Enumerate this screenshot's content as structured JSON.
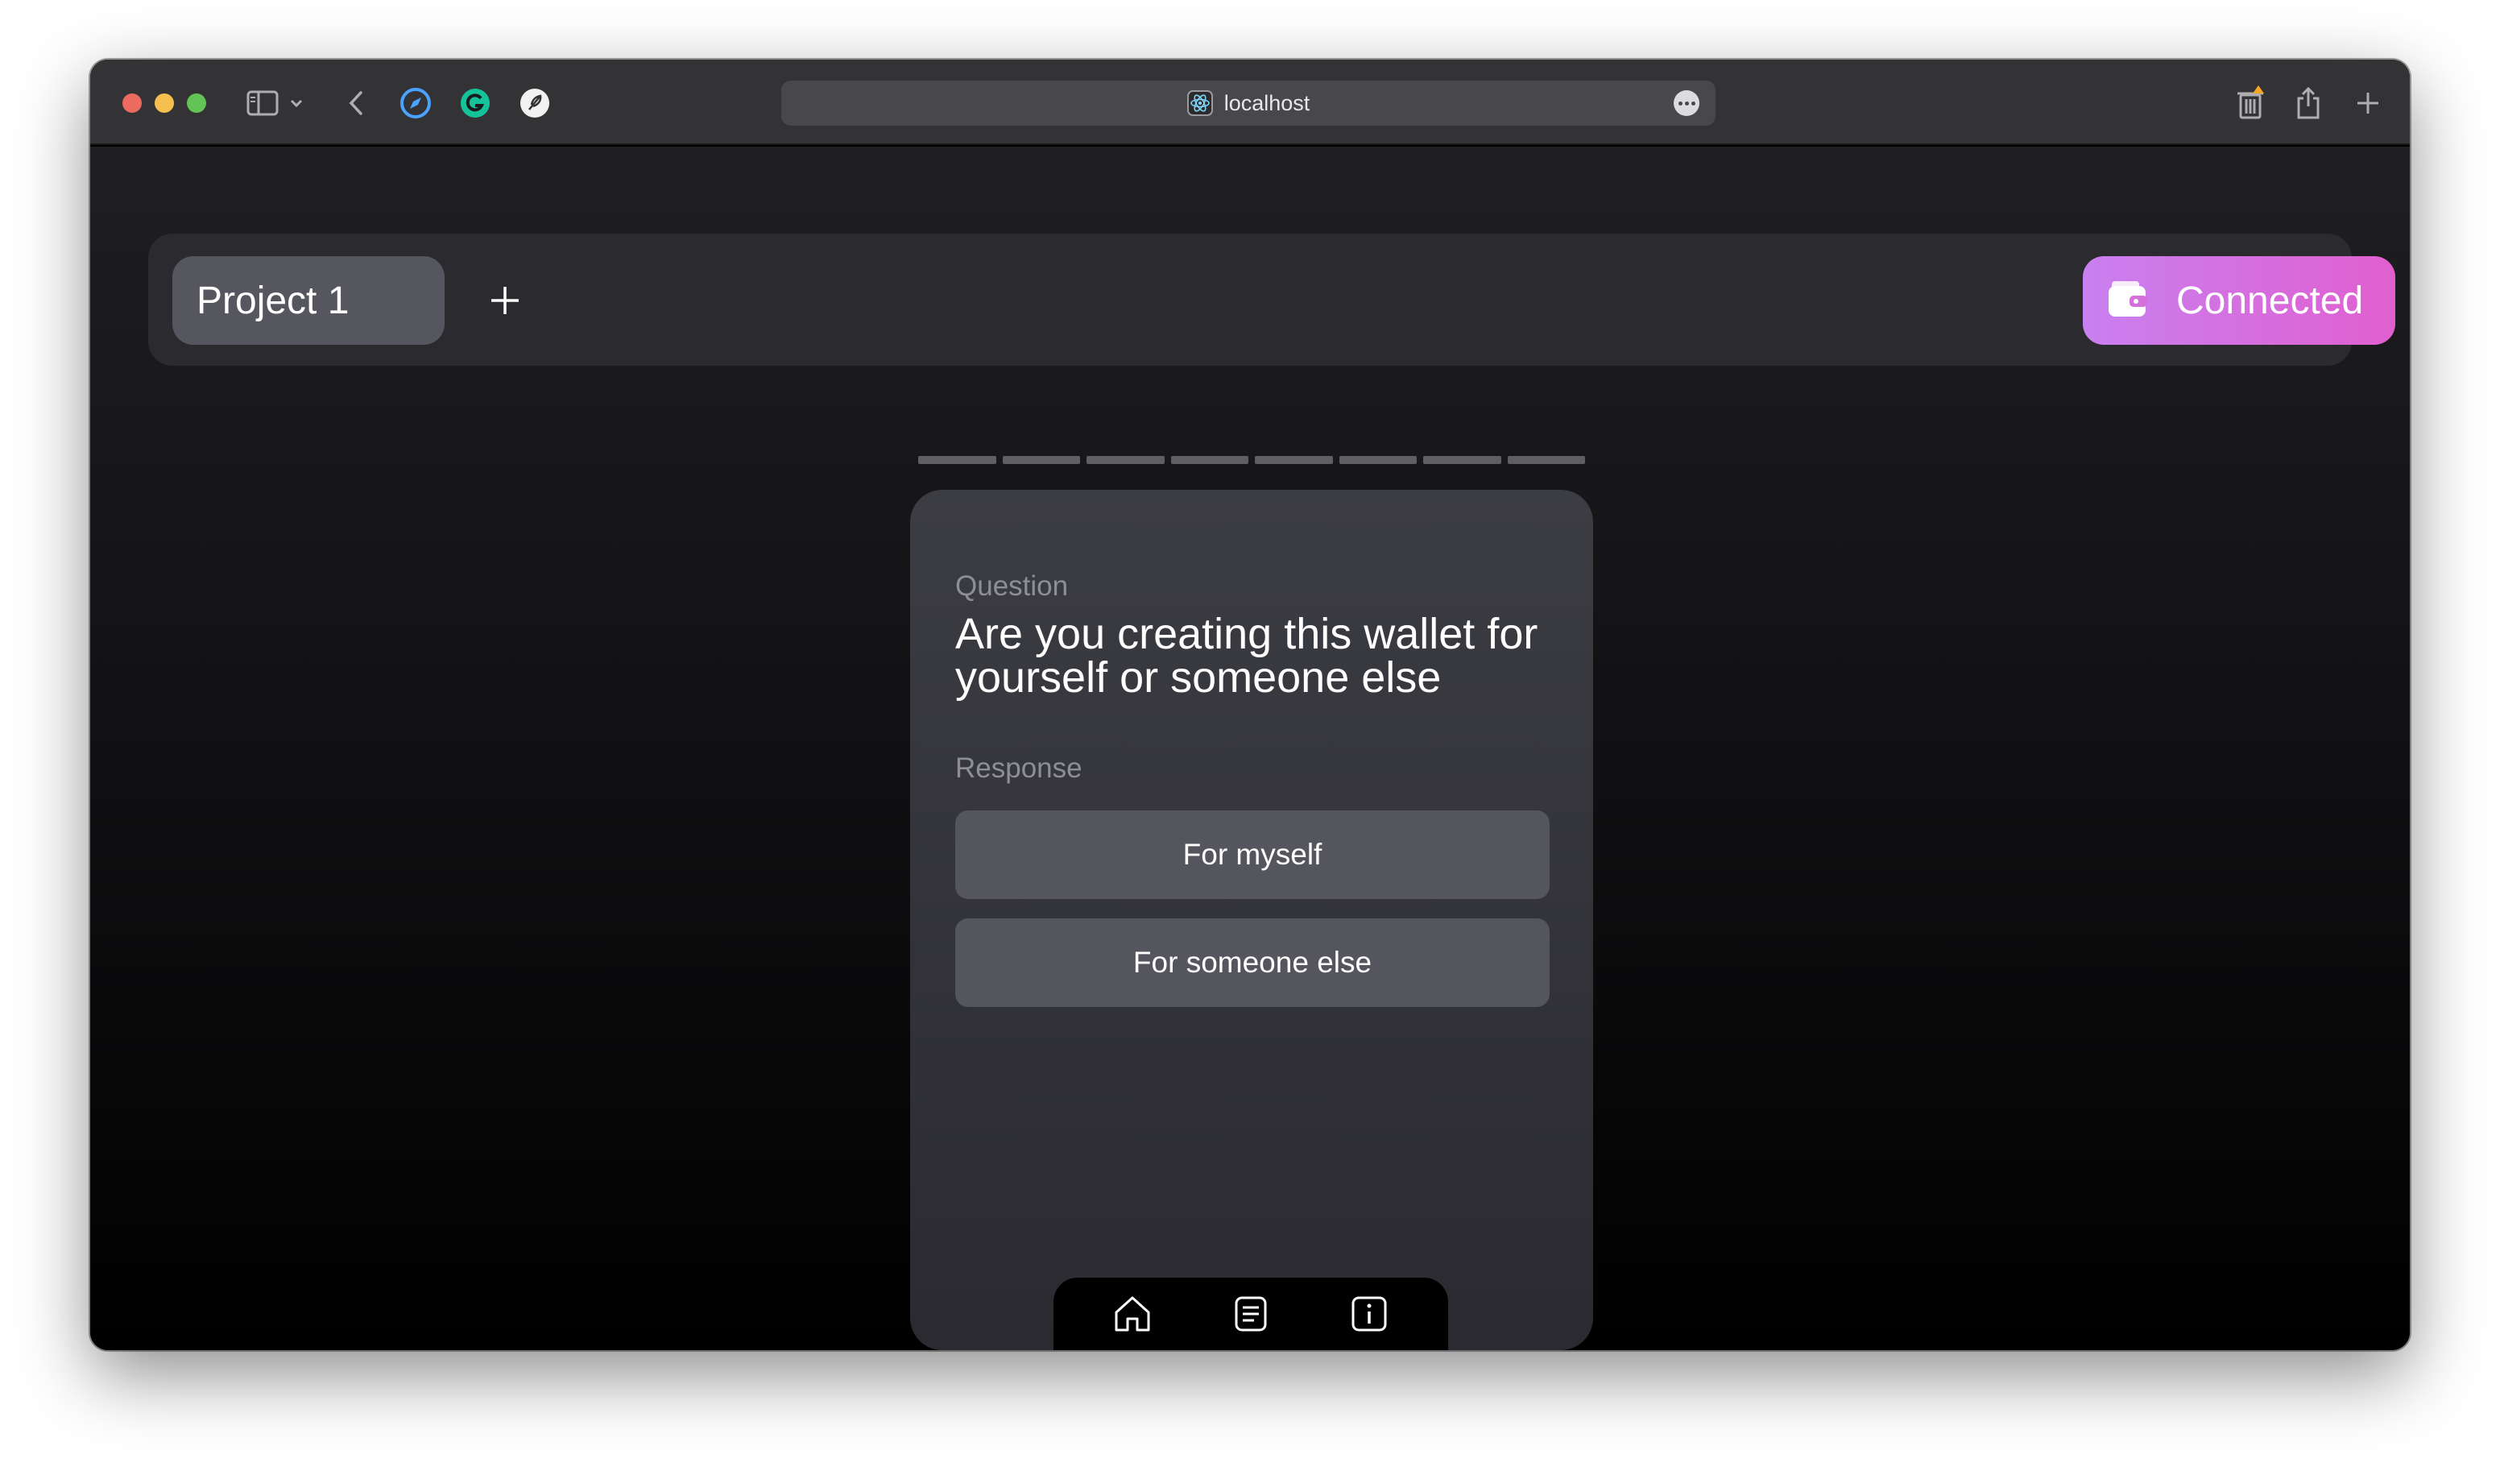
{
  "browser": {
    "url": "localhost",
    "icons": [
      "sidebar-icon",
      "chevron-down-icon",
      "back-icon",
      "compass-icon",
      "grammarly-icon",
      "feather-icon",
      "more-icon",
      "trash-icon",
      "share-icon",
      "plus-icon"
    ]
  },
  "header": {
    "project_tab_label": "Project 1",
    "add_project_icon": "plus-icon",
    "connect_button_label": "Connected",
    "connect_icon": "wallet-icon"
  },
  "progress": {
    "total_segments": 8
  },
  "card": {
    "question_label": "Question",
    "question_text": "Are you creating this wallet for yourself or someone else",
    "response_label": "Response",
    "options": [
      "For myself",
      "For someone else"
    ]
  },
  "bottom_nav": {
    "items": [
      "home-icon",
      "document-icon",
      "info-icon"
    ]
  },
  "colors": {
    "accent_gradient_start": "#c980f0",
    "accent_gradient_end": "#e05fcf",
    "card_bg": "#3c3c43",
    "option_bg": "#55555e"
  }
}
